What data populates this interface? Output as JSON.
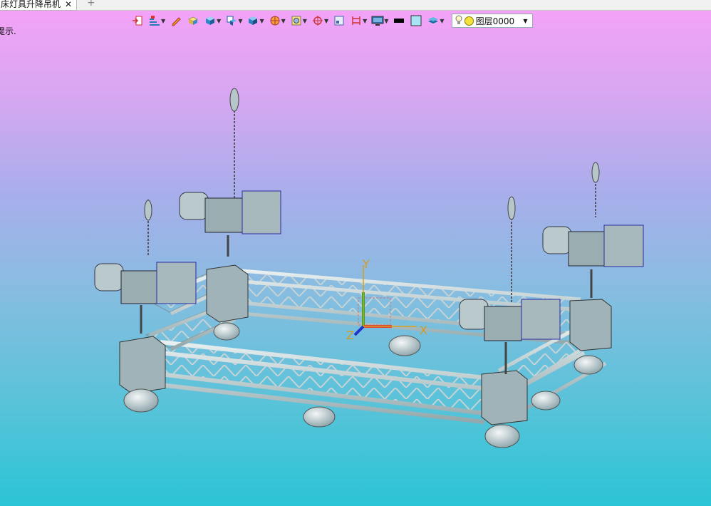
{
  "tabs": [
    {
      "label": "床灯具升降吊机",
      "active": true
    }
  ],
  "tab_add_label": "+",
  "tab_close_label": "✕",
  "toolbar": {
    "icons": [
      "import-icon",
      "fillet-icon",
      "pencil-icon",
      "box-icon",
      "cube-icon",
      "display-mode-icon",
      "shaded-cube-icon",
      "sphere-icon",
      "render-icon",
      "snap-icon",
      "frame-icon",
      "measure-icon",
      "monitor-icon",
      "line-color-icon",
      "fill-color-icon",
      "layers-icon"
    ],
    "layer": {
      "name": "图层0000",
      "color": "#f3e33a"
    }
  },
  "hint_text": "提示.",
  "viewport": {
    "axes": {
      "x": "X",
      "y": "Y",
      "z": "Z"
    },
    "background_top": "#f6a2f8",
    "background_bottom": "#2bc4d6"
  }
}
